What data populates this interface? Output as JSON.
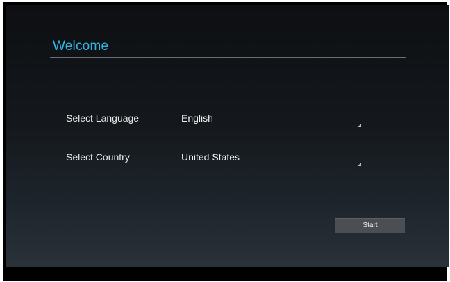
{
  "title": "Welcome",
  "form": {
    "language": {
      "label": "Select Language",
      "value": "English"
    },
    "country": {
      "label": "Select Country",
      "value": "United States"
    }
  },
  "actions": {
    "start_label": "Start"
  },
  "colors": {
    "accent": "#35b2e2",
    "button": "#4b4f54"
  }
}
